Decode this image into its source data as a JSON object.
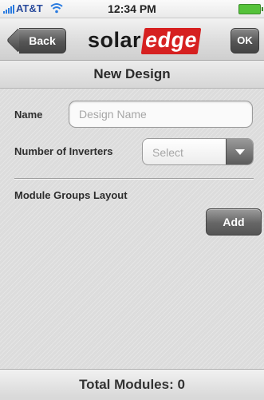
{
  "status_bar": {
    "carrier": "AT&T",
    "time": "12:34 PM",
    "signal_icon": "signal-icon",
    "wifi_icon": "wifi-icon",
    "battery_icon": "battery-icon"
  },
  "nav": {
    "back_label": "Back",
    "logo_part1": "solar",
    "logo_part2": "edge",
    "ok_label": "OK",
    "brand_color": "#d62020"
  },
  "title": "New Design",
  "form": {
    "name_label": "Name",
    "name_placeholder": "Design Name",
    "name_value": "",
    "inverters_label": "Number of Inverters",
    "inverters_selected": "Select",
    "module_groups_label": "Module Groups Layout",
    "add_label": "Add"
  },
  "footer": {
    "total_modules": "Total Modules: 0"
  }
}
